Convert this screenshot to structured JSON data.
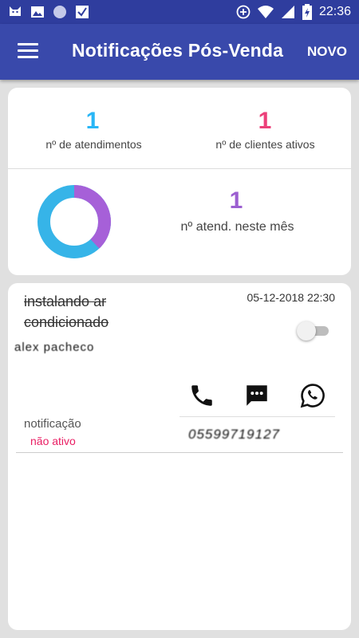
{
  "status_bar": {
    "time": "22:36",
    "left_icons": [
      "cat-icon",
      "image-icon",
      "circle-icon",
      "check-icon"
    ],
    "right_icons": [
      "add-circle-icon",
      "wifi-icon",
      "signal-icon",
      "battery-icon"
    ]
  },
  "app_bar": {
    "title": "Notificações Pós-Venda",
    "action": "NOVO",
    "menu_icon": "menu-icon"
  },
  "summary": {
    "atendimentos": {
      "value": "1",
      "label": "nº de atendimentos",
      "color": "#29b6f6"
    },
    "clientes_ativos": {
      "value": "1",
      "label": "nº de clientes ativos",
      "color": "#ec407a"
    },
    "mes": {
      "value": "1",
      "label": "nº atend. neste mês",
      "color": "#9c5fd1"
    },
    "donut": {
      "segments": [
        {
          "fraction": 0.38,
          "color": "#a660d8"
        },
        {
          "fraction": 0.62,
          "color": "#36b4e8"
        }
      ]
    }
  },
  "item": {
    "title": "instalando ar condicionado",
    "date": "05-12-2018 22:30",
    "client": "alex pacheco",
    "notification_label": "notificação",
    "notification_status": "não ativo",
    "phone": "05599719127",
    "icons": [
      "phone-icon",
      "message-icon",
      "whatsapp-icon"
    ]
  }
}
